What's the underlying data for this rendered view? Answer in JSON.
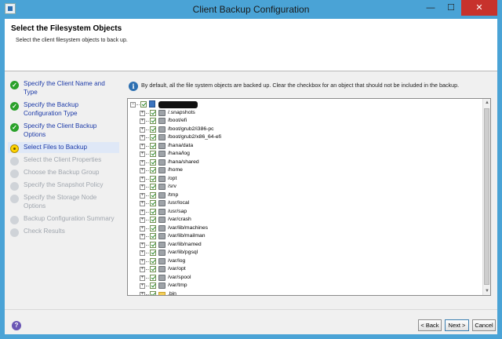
{
  "window": {
    "title": "Client Backup Configuration",
    "controls": {
      "minimize": "—",
      "maximize": "☐",
      "close": "✕"
    }
  },
  "header": {
    "title": "Select the Filesystem Objects",
    "subtitle": "Select the client filesystem objects to back up."
  },
  "steps": [
    {
      "label": "Specify the Client Name and Type",
      "state": "done"
    },
    {
      "label": "Specify the Backup Configuration Type",
      "state": "done"
    },
    {
      "label": "Specify the Client Backup Options",
      "state": "done"
    },
    {
      "label": "Select Files to Backup",
      "state": "current"
    },
    {
      "label": "Select the Client Properties",
      "state": "pending"
    },
    {
      "label": "Choose the Backup Group",
      "state": "pending"
    },
    {
      "label": "Specify the Snapshot Policy",
      "state": "pending"
    },
    {
      "label": "Specify the Storage Node Options",
      "state": "pending"
    },
    {
      "label": "Backup Configuration Summary",
      "state": "pending"
    },
    {
      "label": "Check Results",
      "state": "pending"
    }
  ],
  "info": {
    "text": "By default, all the file system objects are backed up. Clear the checkbox for an object that should not be included in the backup."
  },
  "tree": {
    "root": {
      "label": "",
      "redacted": true,
      "checked": true
    },
    "items": [
      {
        "label": "/.snapshots",
        "type": "drive",
        "checked": true
      },
      {
        "label": "/boot/efi",
        "type": "drive",
        "checked": true
      },
      {
        "label": "/boot/grub2/i386-pc",
        "type": "drive",
        "checked": true
      },
      {
        "label": "/boot/grub2/x86_64-efi",
        "type": "drive",
        "checked": true
      },
      {
        "label": "/hana/data",
        "type": "drive",
        "checked": true
      },
      {
        "label": "/hana/log",
        "type": "drive",
        "checked": true
      },
      {
        "label": "/hana/shared",
        "type": "drive",
        "checked": true
      },
      {
        "label": "/home",
        "type": "drive",
        "checked": true
      },
      {
        "label": "/opt",
        "type": "drive",
        "checked": true
      },
      {
        "label": "/srv",
        "type": "drive",
        "checked": true
      },
      {
        "label": "/tmp",
        "type": "drive",
        "checked": true
      },
      {
        "label": "/usr/local",
        "type": "drive",
        "checked": true
      },
      {
        "label": "/usr/sap",
        "type": "drive",
        "checked": true
      },
      {
        "label": "/var/crash",
        "type": "drive",
        "checked": true
      },
      {
        "label": "/var/lib/machines",
        "type": "drive",
        "checked": true
      },
      {
        "label": "/var/lib/mailman",
        "type": "drive",
        "checked": true
      },
      {
        "label": "/var/lib/named",
        "type": "drive",
        "checked": true
      },
      {
        "label": "/var/lib/pgsql",
        "type": "drive",
        "checked": true
      },
      {
        "label": "/var/log",
        "type": "drive",
        "checked": true
      },
      {
        "label": "/var/opt",
        "type": "drive",
        "checked": true
      },
      {
        "label": "/var/spool",
        "type": "drive",
        "checked": true
      },
      {
        "label": "/var/tmp",
        "type": "drive",
        "checked": true
      },
      {
        "label": ".bin",
        "type": "folder",
        "checked": true
      }
    ]
  },
  "footer": {
    "help": "?",
    "back_label": "< Back",
    "next_label": "Next >",
    "cancel_label": "Cancel"
  },
  "colors": {
    "titlebar": "#4aa3d6",
    "close_button": "#c7322c",
    "link_text": "#1c3aa8",
    "disabled_text": "#a0a6ae",
    "done_check": "#2aa12a",
    "current_step": "#ffd400"
  }
}
